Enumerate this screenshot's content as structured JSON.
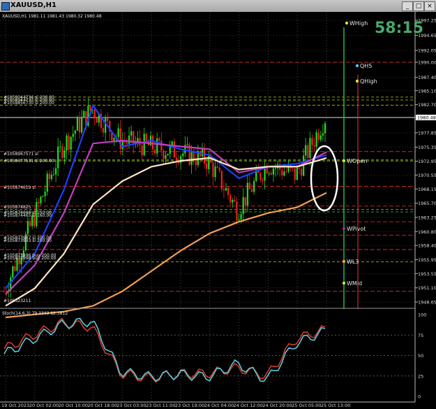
{
  "window": {
    "title": "XAUUSD,H1",
    "controls": [
      "minimize-icon",
      "maximize-icon",
      "close-icon"
    ]
  },
  "header": {
    "ohlc_text": "XAUUSD,H1  1981.11 1981.43 1980.32 1980.48"
  },
  "timer": "58:15",
  "price_axis": {
    "labels": [
      "1997.25",
      "1994.65",
      "1992.05",
      "1990.00",
      "1987.40",
      "1985.10",
      "1982.70",
      "1980.48",
      "1977.85",
      "1975.35",
      "1972.95",
      "1970.55",
      "1968.15",
      "1965.70",
      "1963.25",
      "1960.80",
      "1958.40",
      "1955.95",
      "1953.55",
      "1951.10",
      "1948.65"
    ],
    "current_price": "1980.48"
  },
  "time_axis": {
    "labels": [
      "19 Oct 2023",
      "20 Oct 02:00",
      "20 Oct 10:00",
      "20 Oct 18:00",
      "23 Oct 03:00",
      "23 Oct 11:00",
      "23 Oct 19:00",
      "24 Oct 04:00",
      "24 Oct 12:00",
      "24 Oct 20:00",
      "25 Oct 05:00",
      "25 Oct 13:00"
    ]
  },
  "levels": [
    {
      "name": "WHigh",
      "color": "#d7e238"
    },
    {
      "name": "QH5",
      "color": "#4fc3f7"
    },
    {
      "name": "QHigh",
      "color": "#d7e238"
    },
    {
      "name": "WOpen",
      "color": "#d7e238"
    },
    {
      "name": "WPivot",
      "color": "#9c27b0"
    },
    {
      "name": "WL3",
      "color": "#f5a623"
    },
    {
      "name": "WMid",
      "color": "#d7e238"
    }
  ],
  "order_labels": [
    "#1059044734 sl 200.00",
    "#1058944733 sl 200.00",
    "#1058856730 sl 200.00",
    "#1058967571 sl",
    "#1058677531 sl 200.00",
    "#105874619 sl",
    "#105874825",
    "#105874646 sl 150.00",
    "#105874465 sl 160.00",
    "#105873987 sl 200.00",
    "#105873993 sl 200.00",
    "#105873996 buy 200.00",
    "#105873998 buy 200.00",
    "#105523211"
  ],
  "stochastic": {
    "title": "Stoch(14,6,3) 79.3343 82.3812",
    "axis": [
      "100",
      "75",
      "50",
      "25",
      "0"
    ]
  },
  "chart_data": {
    "type": "candlestick",
    "symbol": "XAUUSD",
    "timeframe": "H1",
    "ylim": [
      1948.65,
      1997.25
    ],
    "x": [
      "19 Oct 2023",
      "20 Oct 02:00",
      "20 Oct 10:00",
      "20 Oct 18:00",
      "23 Oct 03:00",
      "23 Oct 11:00",
      "23 Oct 19:00",
      "24 Oct 04:00",
      "24 Oct 12:00",
      "24 Oct 20:00",
      "25 Oct 05:00",
      "25 Oct 13:00"
    ],
    "close_approx": [
      1950.5,
      1963.0,
      1975.5,
      1982.0,
      1976.5,
      1975.5,
      1974.5,
      1973.0,
      1964.5,
      1972.5,
      1970.5,
      1980.48
    ],
    "series": [
      {
        "values": [
          1951.0,
          1957.0,
          1968.0,
          1982.5,
          1975.5,
          1976.5,
          1975.0,
          1974.0,
          1970.0,
          1972.0,
          1972.5,
          1974.0
        ],
        "color": "#1f3fff"
      },
      {
        "values": [
          1950.0,
          1955.0,
          1964.0,
          1976.0,
          1976.5,
          1976.0,
          1975.5,
          1975.0,
          1971.0,
          1972.0,
          1972.0,
          1974.5
        ],
        "color": "#c040c0"
      },
      {
        "values": [
          1948.0,
          1951.0,
          1957.0,
          1965.5,
          1969.5,
          1972.0,
          1973.0,
          1973.5,
          1971.5,
          1972.0,
          1972.0,
          1973.5
        ],
        "color": "#ffe4c4"
      },
      {
        "values": [
          1946.0,
          1946.5,
          1947.0,
          1948.0,
          1950.5,
          1954.0,
          1957.5,
          1960.5,
          1962.5,
          1964.0,
          1965.0,
          1967.5
        ],
        "color": "#f0a050"
      }
    ],
    "stoch_main": [
      52,
      70,
      88,
      92,
      30,
      24,
      27,
      24,
      40,
      20,
      65,
      80
    ],
    "stoch_signal": [
      58,
      75,
      90,
      85,
      28,
      22,
      28,
      28,
      35,
      25,
      70,
      82
    ]
  }
}
